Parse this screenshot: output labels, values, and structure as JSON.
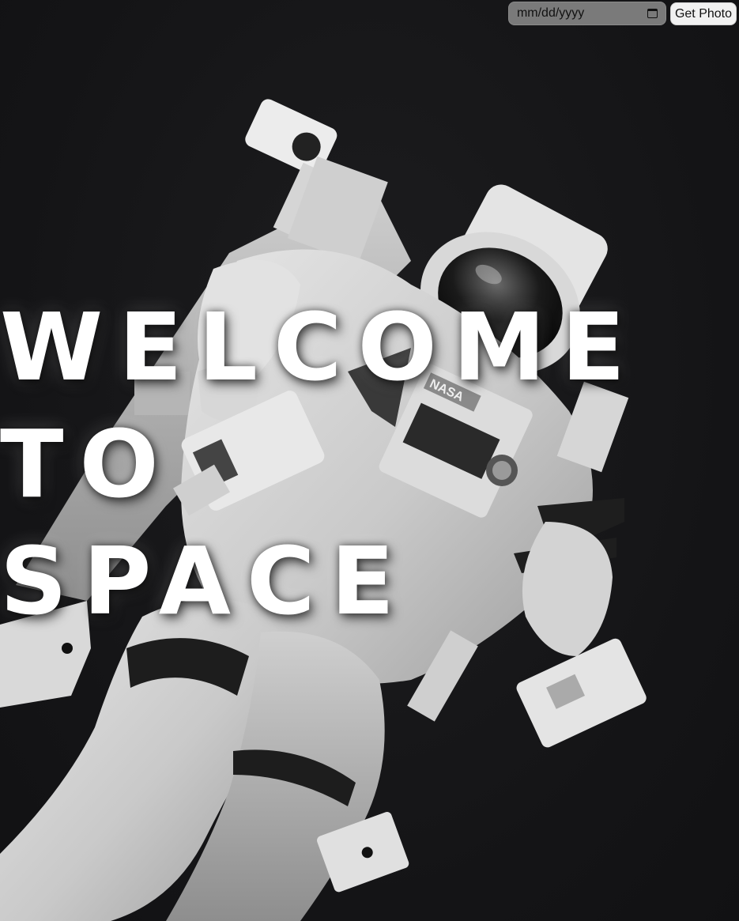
{
  "controls": {
    "date_placeholder": "mm/dd/yyyy",
    "calendar_icon": "calendar-icon",
    "get_photo_label": "Get Photo"
  },
  "headline": {
    "line1": "WELCOME",
    "line2": "TO",
    "line3": "SPACE"
  },
  "photo": {
    "badge_text": "NASA"
  },
  "colors": {
    "background": "#18181a",
    "headline": "#ffffff",
    "date_input_bg": "#7a7a7a",
    "button_bg": "#f1f1f1"
  }
}
